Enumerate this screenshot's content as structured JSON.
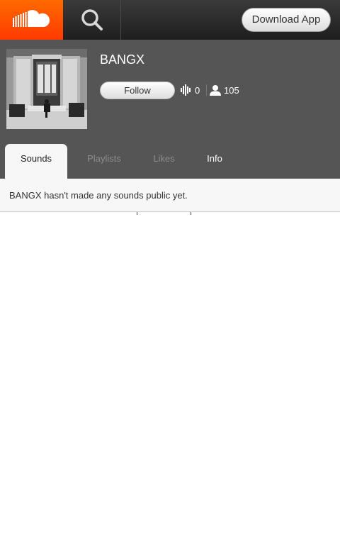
{
  "header": {
    "logo_icon": "soundcloud-cloud-icon",
    "search_icon": "search-icon",
    "download_label": "Download App",
    "brand_color": "#ff5500"
  },
  "profile": {
    "username": "BANGX",
    "follow_label": "Follow",
    "tracks_icon": "waveform-icon",
    "tracks_count": "0",
    "followers_icon": "person-icon",
    "followers_count": "105"
  },
  "tabs": [
    {
      "label": "Sounds",
      "active": true
    },
    {
      "label": "Playlists",
      "active": false
    },
    {
      "label": "Likes",
      "active": false
    },
    {
      "label": "Info",
      "active": false
    }
  ],
  "content": {
    "empty_message": "BANGX hasn't made any sounds public yet."
  }
}
